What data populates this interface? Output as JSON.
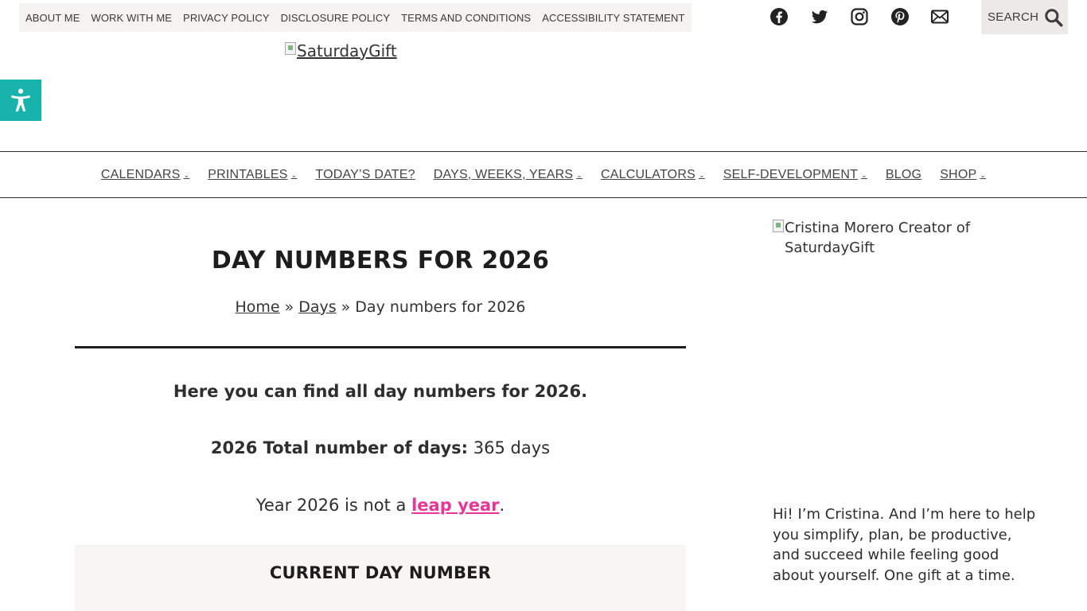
{
  "top_menu": [
    "ABOUT ME",
    "WORK WITH ME",
    "PRIVACY POLICY",
    "DISCLOSURE POLICY",
    "TERMS AND CONDITIONS",
    "ACCESSIBILITY STATEMENT"
  ],
  "social_icons": [
    "facebook-icon",
    "twitter-icon",
    "instagram-icon",
    "pinterest-icon",
    "email-icon"
  ],
  "search": {
    "label": "SEARCH",
    "icon": "search-icon"
  },
  "accessibility": {
    "icon": "accessibility-icon",
    "color": "#18b4ac"
  },
  "logo": {
    "alt": "SaturdayGift"
  },
  "nav": [
    {
      "label": "CALENDARS",
      "has_dropdown": true
    },
    {
      "label": "PRINTABLES",
      "has_dropdown": true
    },
    {
      "label": "TODAY’S DATE?",
      "has_dropdown": false
    },
    {
      "label": "DAYS, WEEKS, YEARS",
      "has_dropdown": true
    },
    {
      "label": "CALCULATORS",
      "has_dropdown": true
    },
    {
      "label": "SELF-DEVELOPMENT",
      "has_dropdown": true
    },
    {
      "label": "BLOG",
      "has_dropdown": false
    },
    {
      "label": "SHOP",
      "has_dropdown": true
    }
  ],
  "main": {
    "title": "DAY NUMBERS FOR 2026",
    "breadcrumb": {
      "home": "Home",
      "sep1": "»",
      "days": "Days",
      "sep2": "»",
      "current": "Day numbers for 2026"
    },
    "intro": "Here you can find all day numbers for 2026.",
    "total_label": "2026 Total number of days:",
    "total_value": " 365 days",
    "leap_prefix": "Year 2026 is not a ",
    "leap_link": "leap year",
    "leap_suffix": ".",
    "card_title": "CURRENT DAY NUMBER"
  },
  "sidebar": {
    "author_img_alt": "Cristina Morero Creator of SaturdayGift",
    "bio": "Hi! I’m Cristina. And I’m here to help you simplify, plan, be productive, and succeed while feeling good about yourself. One gift at a time."
  },
  "colors": {
    "accent_pink": "#e8359a",
    "teal": "#18b4ac",
    "card_bg": "#f8f6f3"
  }
}
